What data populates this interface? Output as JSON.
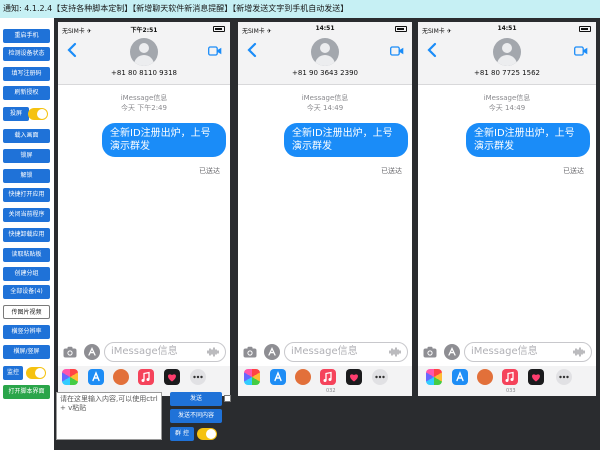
{
  "topbar": {
    "text": "通知:  4.1.2.4【支持各种脚本定制】【新增聊天软件新消息提醒】【新增发送文字到手机自动发送】"
  },
  "sidebar": {
    "buttons": [
      "重启手机",
      "检测设备状态",
      "填写注册码",
      "刷新授权",
      "投屏",
      "载入画面",
      "锁屏",
      "解锁",
      "快捷打开应用",
      "关闭当前程序",
      "快捷卸载应用",
      "读取粘贴板",
      "创建分组",
      "全部设备(4)",
      "传图片视频",
      "横竖分辨率",
      "横屏/竖屏",
      "监控",
      "打开脚本界面"
    ]
  },
  "phones": [
    {
      "carrier": "无SIM卡 ✈",
      "time": "下午2:51",
      "number": "+81 80 8110 9318",
      "service": "iMessage信息",
      "timestamp": "今天 下午2:49",
      "message": "全新ID注册出炉，上号演示群发",
      "delivered": "已送达",
      "placeholder": "iMessage信息",
      "footer": ""
    },
    {
      "carrier": "无SIM卡 ✈",
      "time": "14:51",
      "number": "+81 90 3643 2390",
      "service": "iMessage信息",
      "timestamp": "今天 14:49",
      "message": "全新ID注册出炉，上号演示群发",
      "delivered": "已送达",
      "placeholder": "iMessage信息",
      "footer": "032"
    },
    {
      "carrier": "无SIM卡 ✈",
      "time": "14:51",
      "number": "+81 80 7725 1562",
      "service": "iMessage信息",
      "timestamp": "今天 14:49",
      "message": "全新ID注册出炉，上号演示群发",
      "delivered": "已送达",
      "placeholder": "iMessage信息",
      "footer": "033"
    }
  ],
  "bottom": {
    "input_placeholder": "请在这里输入内容,可以使用ctrl + v粘贴",
    "send_label": "发送",
    "send_keep_label": "发送不同内容",
    "group_control_label": "群 控"
  },
  "colors": {
    "accent": "#1f72d8",
    "bubble": "#1a8cf8",
    "toggle": "#f5c211",
    "green": "#2aa54a"
  },
  "icons": {
    "app_bar": [
      "photos-icon",
      "app-store-icon",
      "memoji-icon",
      "music-icon",
      "heart-icon",
      "more-icon"
    ]
  }
}
